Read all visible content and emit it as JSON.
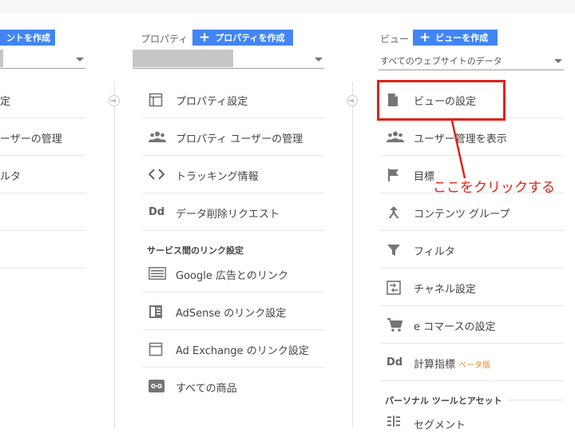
{
  "account_column": {
    "create_button": "ントを作成",
    "items": [
      {
        "label": "定"
      },
      {
        "label": "ーザーの管理"
      },
      {
        "label": "ルタ"
      }
    ]
  },
  "property_column": {
    "title": "プロパティ",
    "create_button": "プロパティを作成",
    "items": [
      {
        "icon": "layout-icon",
        "label": "プロパティ設定"
      },
      {
        "icon": "people-icon",
        "label": "プロパティ ユーザーの管理"
      },
      {
        "icon": "code-icon",
        "label": "トラッキング情報"
      },
      {
        "icon": "dd-icon",
        "label": "データ削除リクエスト"
      }
    ],
    "section_heading": "サービス間のリンク設定",
    "link_items": [
      {
        "icon": "ads-icon",
        "label": "Google 広告とのリンク"
      },
      {
        "icon": "adsense-icon",
        "label": "AdSense のリンク設定"
      },
      {
        "icon": "adexchange-icon",
        "label": "Ad Exchange のリンク設定"
      },
      {
        "icon": "link-icon",
        "label": "すべての商品"
      }
    ]
  },
  "view_column": {
    "title": "ビュー",
    "create_button": "ビューを作成",
    "selected_view": "すべてのウェブサイトのデータ",
    "items": [
      {
        "icon": "document-icon",
        "label": "ビューの設定"
      },
      {
        "icon": "people-icon",
        "label": "ユーザー管理を表示"
      },
      {
        "icon": "flag-icon",
        "label": "目標"
      },
      {
        "icon": "content-group-icon",
        "label": "コンテンツ グループ"
      },
      {
        "icon": "filter-icon",
        "label": "フィルタ"
      },
      {
        "icon": "channel-icon",
        "label": "チャネル設定"
      },
      {
        "icon": "cart-icon",
        "label": "e コマースの設定"
      },
      {
        "icon": "dd-icon",
        "label": "計算指標",
        "badge": "ベータ版"
      }
    ],
    "section_heading": "パーソナル ツールとアセット",
    "tool_items": [
      {
        "icon": "segment-icon",
        "label": "セグメント"
      }
    ]
  },
  "annotation": {
    "text": "ここをクリックする",
    "color": "#e32119"
  },
  "colors": {
    "button_blue": "#4285f4",
    "icon_gray": "#757575",
    "beta_orange": "#f4821f"
  }
}
